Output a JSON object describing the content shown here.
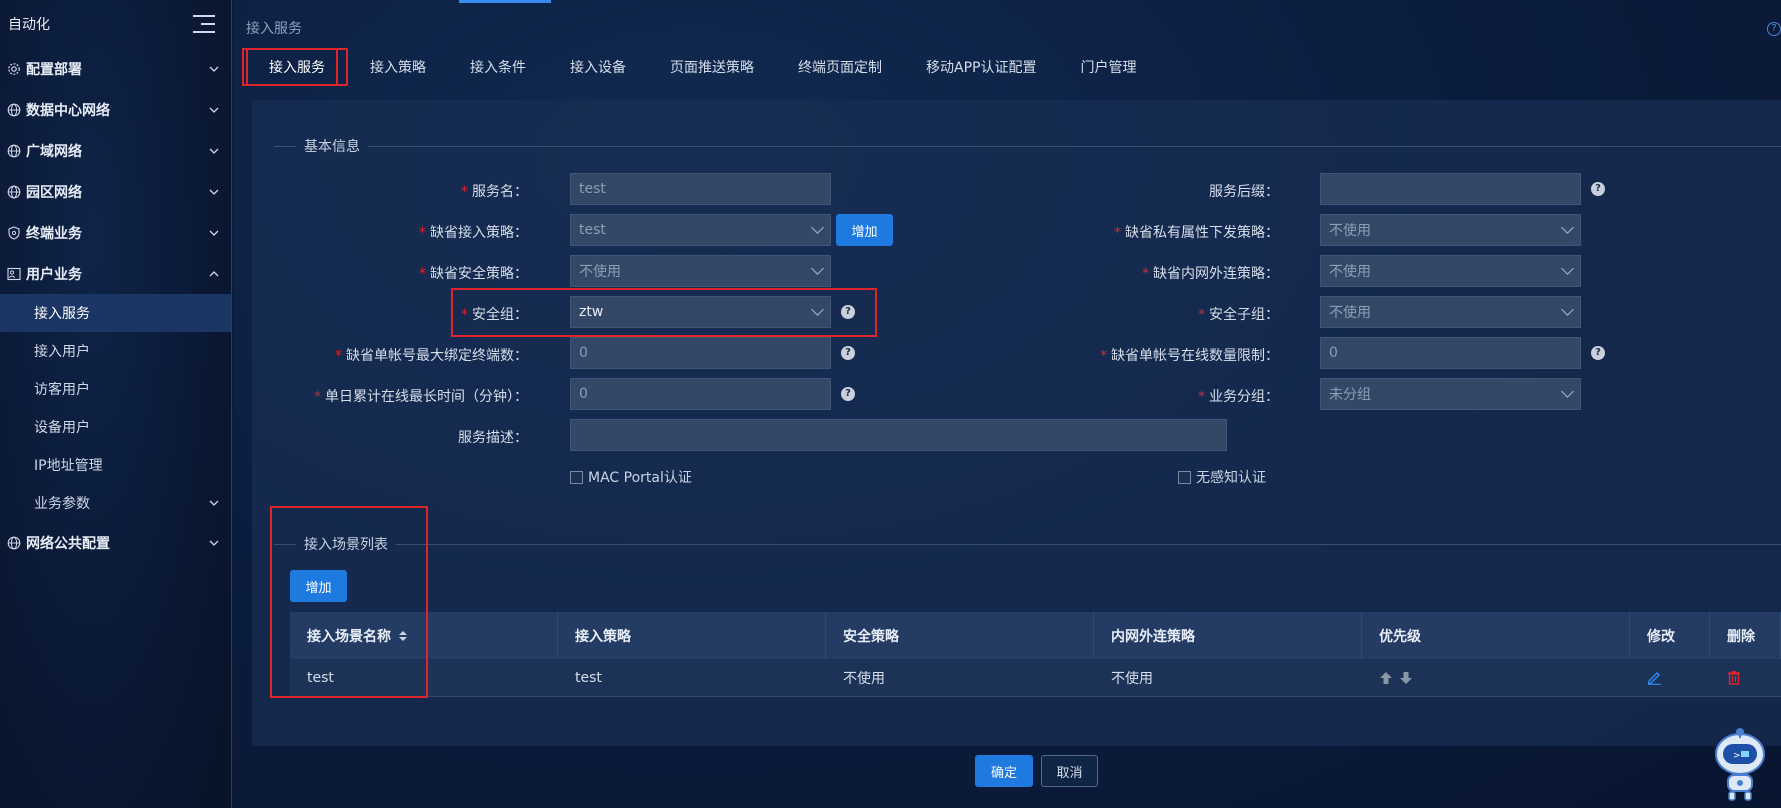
{
  "sidebar": {
    "title": "自动化",
    "items": [
      {
        "label": "配置部署",
        "icon": "gear-icon"
      },
      {
        "label": "数据中心网络",
        "icon": "globe-icon"
      },
      {
        "label": "广域网络",
        "icon": "globe-icon"
      },
      {
        "label": "园区网络",
        "icon": "globe-icon"
      },
      {
        "label": "终端业务",
        "icon": "shield-icon"
      },
      {
        "label": "用户业务",
        "icon": "user-group-icon"
      }
    ],
    "sub_items": [
      {
        "label": "接入服务",
        "active": true
      },
      {
        "label": "接入用户"
      },
      {
        "label": "访客用户"
      },
      {
        "label": "设备用户"
      },
      {
        "label": "IP地址管理"
      },
      {
        "label": "业务参数"
      }
    ],
    "bottom_item": {
      "label": "网络公共配置",
      "icon": "globe-icon"
    }
  },
  "header": {
    "breadcrumb": "接入服务",
    "help": "?"
  },
  "tabs": [
    {
      "label": "接入服务",
      "active": true
    },
    {
      "label": "接入策略"
    },
    {
      "label": "接入条件"
    },
    {
      "label": "接入设备"
    },
    {
      "label": "页面推送策略"
    },
    {
      "label": "终端页面定制"
    },
    {
      "label": "移动APP认证配置"
    },
    {
      "label": "门户管理"
    }
  ],
  "basic": {
    "legend": "基本信息",
    "required_mark": "*",
    "service_name": {
      "label": "服务名：",
      "value": "test"
    },
    "service_suffix": {
      "label": "服务后缀：",
      "value": ""
    },
    "default_access_policy": {
      "label": "缺省接入策略：",
      "value": "test",
      "add_label": "增加"
    },
    "default_private_policy": {
      "label": "缺省私有属性下发策略：",
      "value": "不使用"
    },
    "default_security_policy": {
      "label": "缺省安全策略：",
      "value": "不使用"
    },
    "default_intranet_policy": {
      "label": "缺省内网外连策略：",
      "value": "不使用"
    },
    "security_group": {
      "label": "安全组：",
      "value": "ztw"
    },
    "security_subgroup": {
      "label": "安全子组：",
      "value": "不使用"
    },
    "max_bind_terminals": {
      "label": "缺省单帐号最大绑定终端数：",
      "value": "0"
    },
    "max_online": {
      "label": "缺省单帐号在线数量限制：",
      "value": "0"
    },
    "daily_max_time": {
      "label": "单日累计在线最长时间（分钟）：",
      "value": "0"
    },
    "service_group": {
      "label": "业务分组：",
      "value": "未分组"
    },
    "description": {
      "label": "服务描述：",
      "value": ""
    },
    "mac_portal": "MAC Portal认证",
    "no_perception": "无感知认证",
    "help": "?"
  },
  "scenes": {
    "legend": "接入场景列表",
    "add_label": "增加",
    "columns": [
      "接入场景名称",
      "接入策略",
      "安全策略",
      "内网外连策略",
      "优先级",
      "修改",
      "删除"
    ],
    "rows": [
      {
        "name": "test",
        "access_policy": "test",
        "security_policy": "不使用",
        "intranet_policy": "不使用"
      }
    ]
  },
  "footer": {
    "confirm": "确定",
    "cancel": "取消"
  },
  "colors": {
    "accent": "#1f7ae0",
    "highlight": "#e0242b",
    "delete": "#e0242b",
    "edit": "#2f8bf0"
  }
}
